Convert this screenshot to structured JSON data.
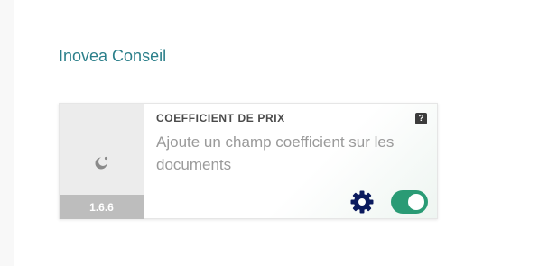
{
  "section": {
    "title": "Inovea Conseil"
  },
  "module": {
    "title": "COEFFICIENT DE PRIX",
    "description": "Ajoute un champ coefficient sur les documents",
    "version": "1.6.6",
    "help_glyph": "?",
    "logo_icon": "module-logo-icon",
    "settings_icon": "gear-icon",
    "enabled": true,
    "colors": {
      "accent": "#2b7f8a",
      "toggle_on": "#2a9b75",
      "settings": "#0b1a5e"
    }
  }
}
